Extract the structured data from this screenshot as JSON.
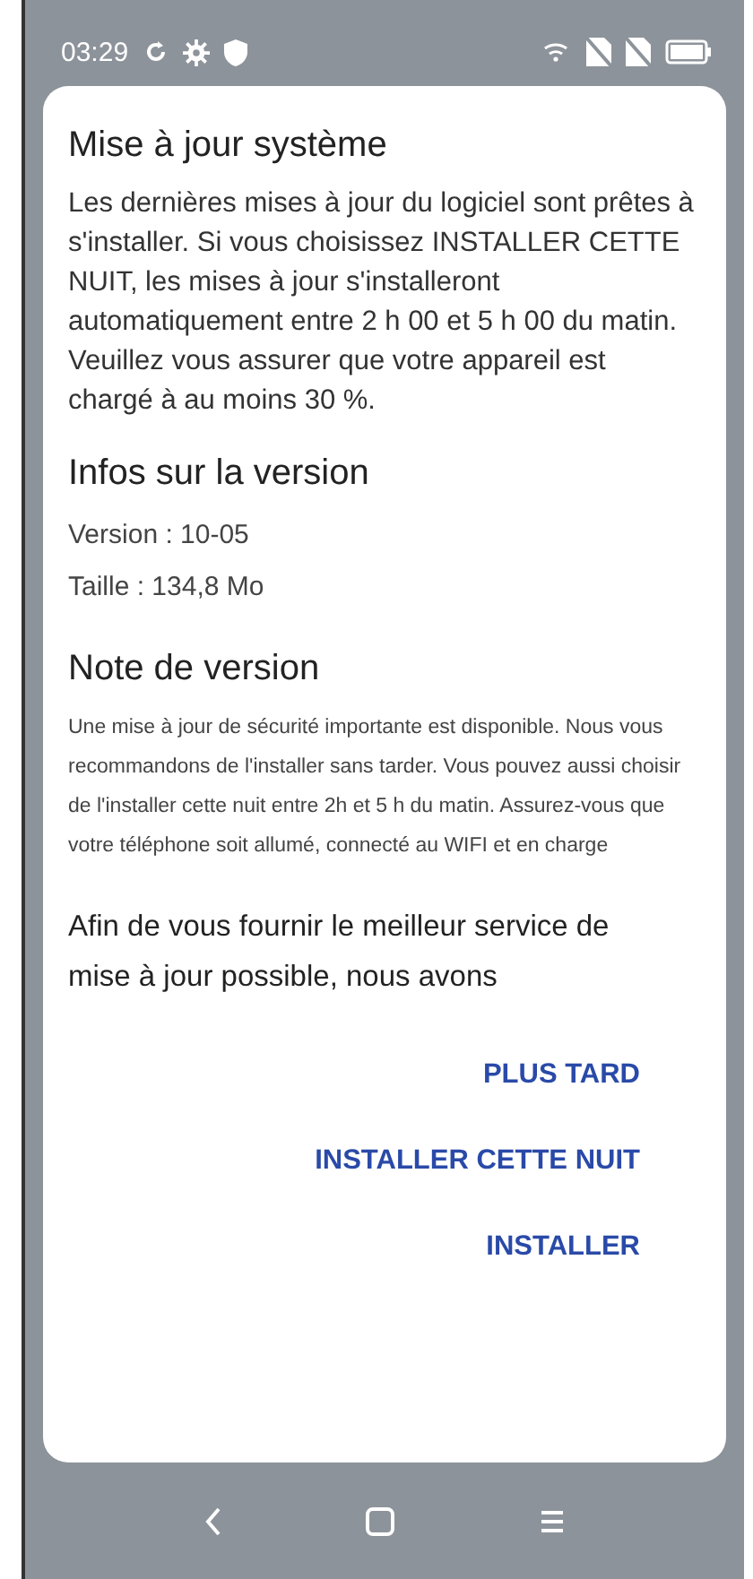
{
  "status_bar": {
    "time": "03:29"
  },
  "dialog": {
    "title": "Mise à jour système",
    "intro": "Les dernières mises à jour du logiciel sont prêtes à s'installer. Si vous choisissez INSTALLER CETTE NUIT, les mises à jour s'installeront automatiquement entre 2 h 00 et 5 h 00 du matin. Veuillez vous assurer que votre appareil est chargé à au moins 30 %.",
    "version_heading": "Infos sur la version",
    "version": "Version : 10-05",
    "size": "Taille : 134,8 Mo",
    "notes_heading": "Note de version",
    "notes": "Une mise à jour de sécurité importante est disponible. Nous vous recommandons de l'installer sans tarder. Vous pouvez aussi choisir de l'installer cette nuit entre 2h et 5 h du matin. Assurez-vous que votre téléphone soit allumé, connecté au WIFI et en charge",
    "extra": "Afin de vous fournir le meilleur service de mise à jour possible, nous avons",
    "buttons": [
      "PLUS TARD",
      "INSTALLER CETTE NUIT",
      "INSTALLER"
    ]
  }
}
